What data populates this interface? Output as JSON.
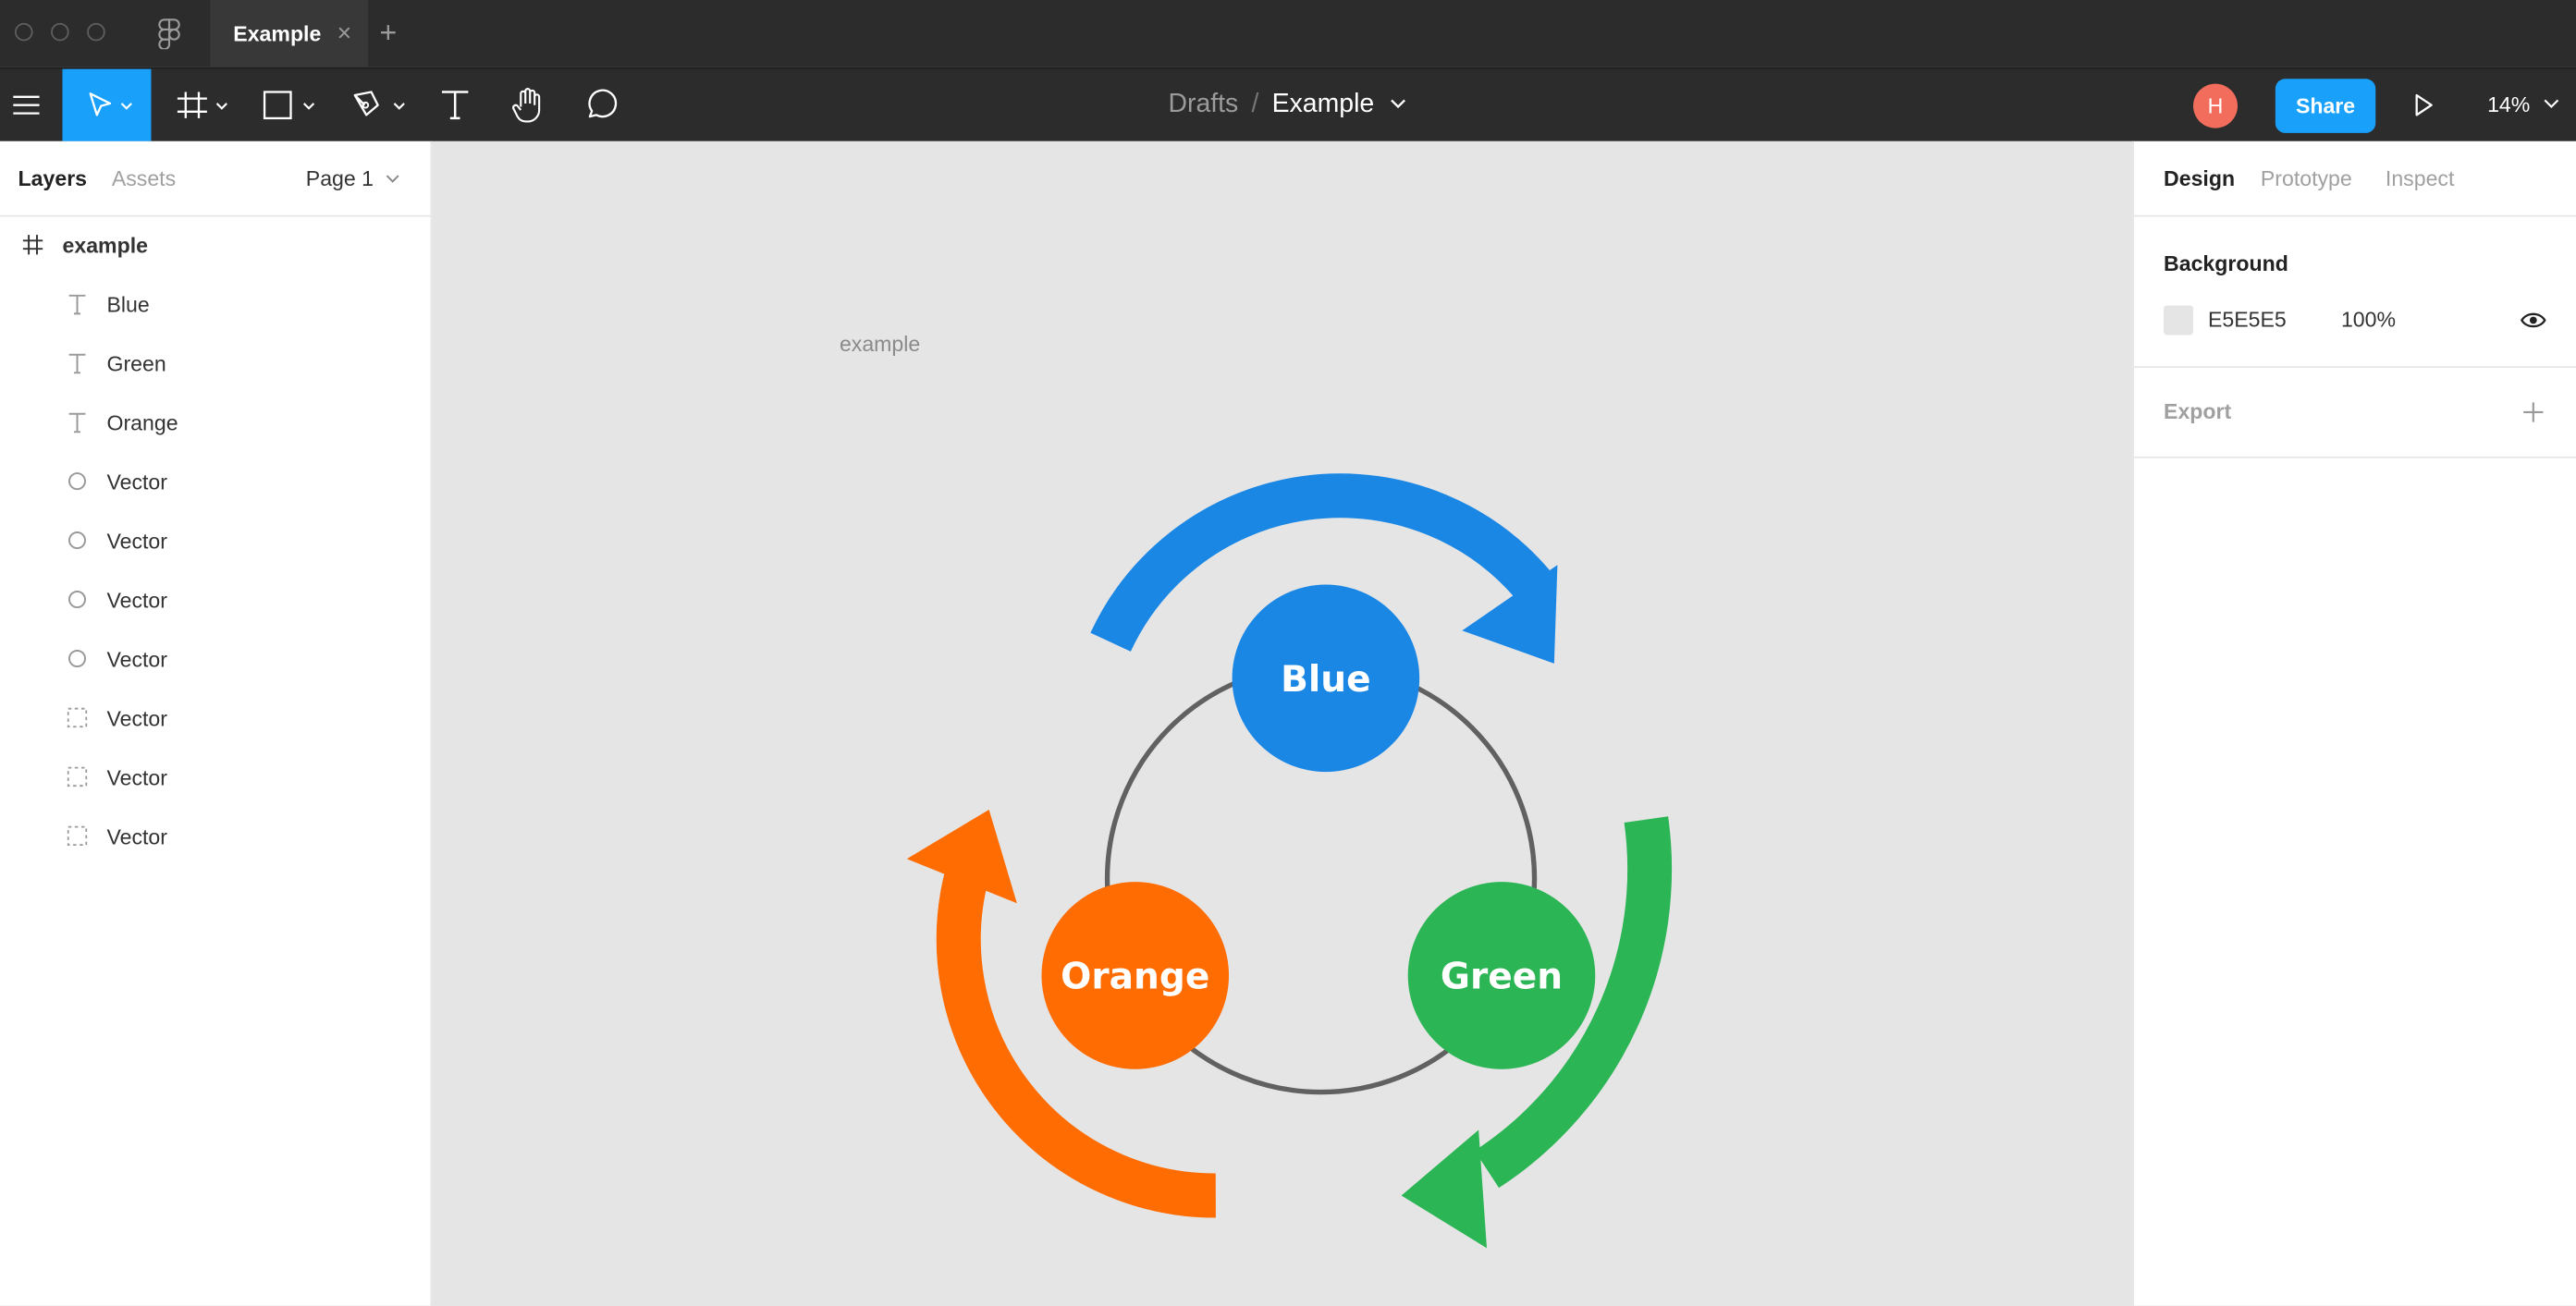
{
  "tab": {
    "title": "Example",
    "close": "×",
    "new_tab": "+"
  },
  "breadcrumb": {
    "parent": "Drafts",
    "separator": "/",
    "file": "Example"
  },
  "user": {
    "initial": "H"
  },
  "toolbar": {
    "share_label": "Share",
    "zoom": "14%"
  },
  "left_panel": {
    "tabs": [
      "Layers",
      "Assets"
    ],
    "page_selector": "Page 1",
    "frame": "example",
    "layers": [
      {
        "name": "Blue",
        "type": "text"
      },
      {
        "name": "Green",
        "type": "text"
      },
      {
        "name": "Orange",
        "type": "text"
      },
      {
        "name": "Vector",
        "type": "ellipse"
      },
      {
        "name": "Vector",
        "type": "ellipse"
      },
      {
        "name": "Vector",
        "type": "ellipse"
      },
      {
        "name": "Vector",
        "type": "ellipse"
      },
      {
        "name": "Vector",
        "type": "vector"
      },
      {
        "name": "Vector",
        "type": "vector"
      },
      {
        "name": "Vector",
        "type": "vector"
      }
    ]
  },
  "canvas": {
    "frame_label": "example",
    "nodes": [
      {
        "label": "Blue",
        "color": "#1b87e5"
      },
      {
        "label": "Orange",
        "color": "#ff6c02"
      },
      {
        "label": "Green",
        "color": "#2bb554"
      }
    ]
  },
  "right_panel": {
    "tabs": [
      "Design",
      "Prototype",
      "Inspect"
    ],
    "background_title": "Background",
    "background_hex": "E5E5E5",
    "background_opacity": "100%",
    "export_title": "Export"
  },
  "colors": {
    "accent": "#18a0fb",
    "toolbar_bg": "#2c2c2c",
    "avatar": "#f26d5b",
    "canvas_bg": "#e5e5e5"
  }
}
